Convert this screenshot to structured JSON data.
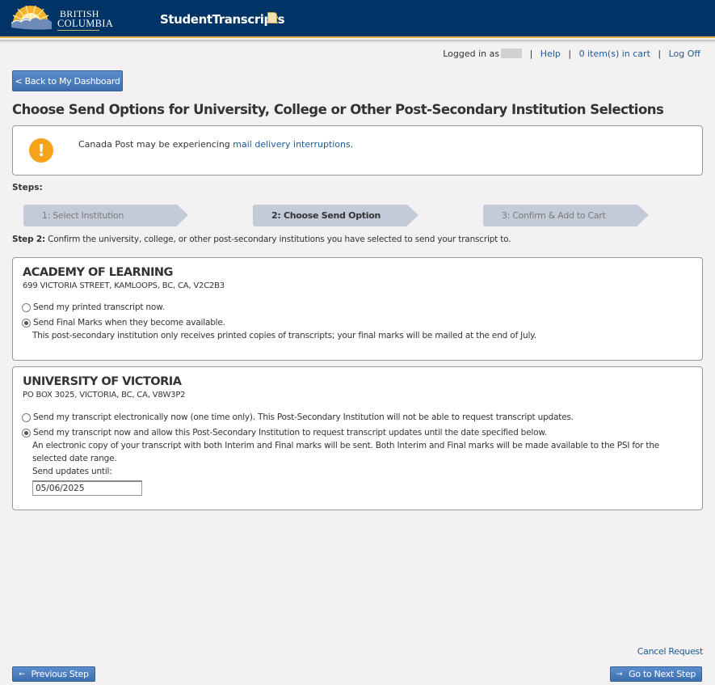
{
  "header": {
    "logo_line1": "BRITISH",
    "logo_line2": "COLUMBIA",
    "app_title": "StudentTranscripts"
  },
  "top_links": {
    "logged_in_label": "Logged in as",
    "help": "Help",
    "cart": "0 item(s) in cart",
    "log_off": "Log Off"
  },
  "back_button": "< Back to My Dashboard",
  "page_title": "Choose Send Options for University, College or Other Post-Secondary Institution Selections",
  "alert": {
    "text": "Canada Post may be experiencing ",
    "link": "mail delivery interruptions",
    "suffix": "."
  },
  "steps": {
    "label": "Steps:",
    "items": [
      {
        "label": "1: Select Institution",
        "active": false
      },
      {
        "label": "2: Choose Send Option",
        "active": true
      },
      {
        "label": "3: Confirm & Add to Cart",
        "active": false
      }
    ],
    "description_bold": "Step 2:",
    "description": " Confirm the university, college, or other post-secondary institutions you have selected to send your transcript to."
  },
  "institutions": [
    {
      "name": "ACADEMY OF LEARNING",
      "address": "699 VICTORIA STREET, KAMLOOPS, BC, CA, V2C2B3",
      "options": [
        {
          "label": "Send my printed transcript now.",
          "checked": false
        },
        {
          "label": "Send Final Marks when they become available.",
          "checked": true
        }
      ],
      "note": "This post-secondary institution only receives printed copies of transcripts; your final marks will be mailed at the end of July."
    },
    {
      "name": "UNIVERSITY OF VICTORIA",
      "address": "PO BOX 3025, VICTORIA, BC, CA, V8W3P2",
      "options": [
        {
          "label": "Send my transcript electronically now (one time only). This Post-Secondary Institution will not be able to request transcript updates.",
          "checked": false
        },
        {
          "label": "Send my transcript now and allow this Post-Secondary Institution to request transcript updates until the date specified below.",
          "checked": true
        }
      ],
      "note": "An electronic copy of your transcript with both Interim and Final marks will be sent. Both Interim and Final marks will be made available to the PSI for the selected date range.",
      "send_updates_label": "Send updates until:",
      "send_updates_value": "05/06/2025"
    }
  ],
  "footer": {
    "cancel": "Cancel Request",
    "previous": "Previous Step",
    "next": "Go to Next Step",
    "previous_icon": "←",
    "next_icon": "→"
  },
  "colors": {
    "header_bg": "#003366",
    "header_accent": "#e3b23c",
    "button_blue": "#4a7bbd",
    "link_blue": "#1f5a94",
    "step_bg": "#c3cad8",
    "alert_orange": "#f7a21b"
  }
}
